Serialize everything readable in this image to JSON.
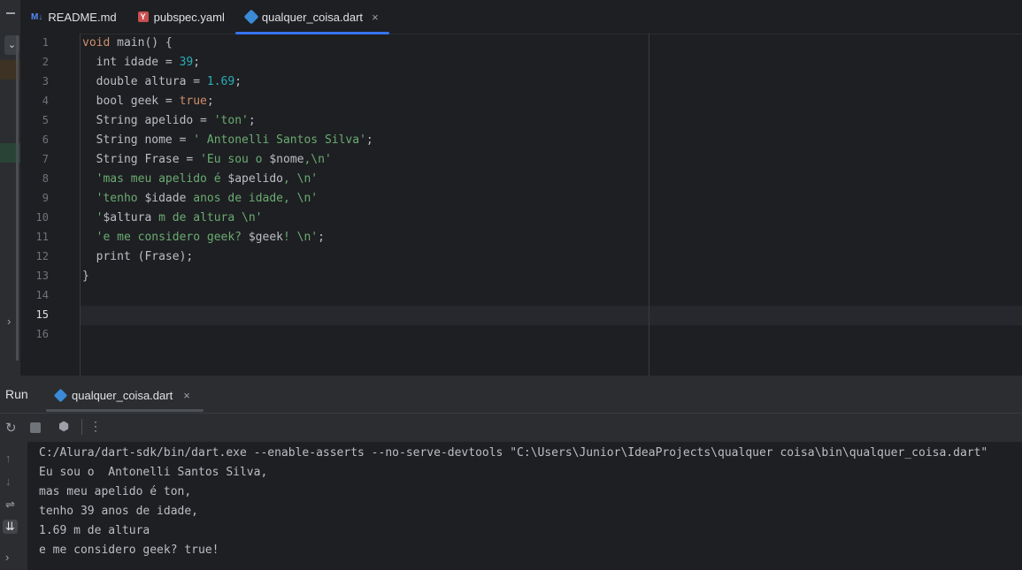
{
  "tabs": [
    {
      "icon": "M↓",
      "label": "README.md"
    },
    {
      "icon": "Y",
      "label": "pubspec.yaml"
    },
    {
      "icon": "dart",
      "label": "qualquer_coisa.dart",
      "close": "×"
    }
  ],
  "line_numbers": [
    "1",
    "2",
    "3",
    "4",
    "5",
    "6",
    "7",
    "8",
    "9",
    "10",
    "11",
    "12",
    "13",
    "14",
    "15",
    "16"
  ],
  "code": {
    "l1_kw": "void",
    "l1_rest": " main() {",
    "l2_a": "  int idade = ",
    "l2_num": "39",
    "l2_b": ";",
    "l3_a": "  double altura = ",
    "l3_num": "1.69",
    "l3_b": ";",
    "l4_a": "  bool geek = ",
    "l4_kw": "true",
    "l4_b": ";",
    "l5_a": "  String apelido = ",
    "l5_str": "'ton'",
    "l5_b": ";",
    "l6_a": "  String nome = ",
    "l6_str": "' Antonelli Santos Silva'",
    "l6_b": ";",
    "l7_a": "  String Frase = ",
    "l7_str1": "'Eu sou o ",
    "l7_var": "$nome",
    "l7_str2": ",\\n'",
    "l8_str1": "  'mas meu apelido é ",
    "l8_var": "$apelido",
    "l8_str2": ", \\n'",
    "l9_str1": "  'tenho ",
    "l9_var": "$idade",
    "l9_str2": " anos de idade, \\n'",
    "l10_str1": "  '",
    "l10_var": "$altura",
    "l10_str2": " m de altura \\n'",
    "l11_str1": "  'e me considero geek? ",
    "l11_var": "$geek",
    "l11_str2": "! \\n'",
    "l11_b": ";",
    "l12": "  print (Frase);",
    "l13": "}"
  },
  "run": {
    "title": "Run",
    "tab_label": "qualquer_coisa.dart",
    "tab_close": "×",
    "menu_icon": "⋮"
  },
  "console": [
    "C:/Alura/dart-sdk/bin/dart.exe --enable-asserts --no-serve-devtools \"C:\\Users\\Junior\\IdeaProjects\\qualquer coisa\\bin\\qualquer_coisa.dart\"",
    "Eu sou o  Antonelli Santos Silva,",
    "mas meu apelido é ton,",
    "tenho 39 anos de idade,",
    "1.69 m de altura",
    "e me considero geek? true!"
  ]
}
